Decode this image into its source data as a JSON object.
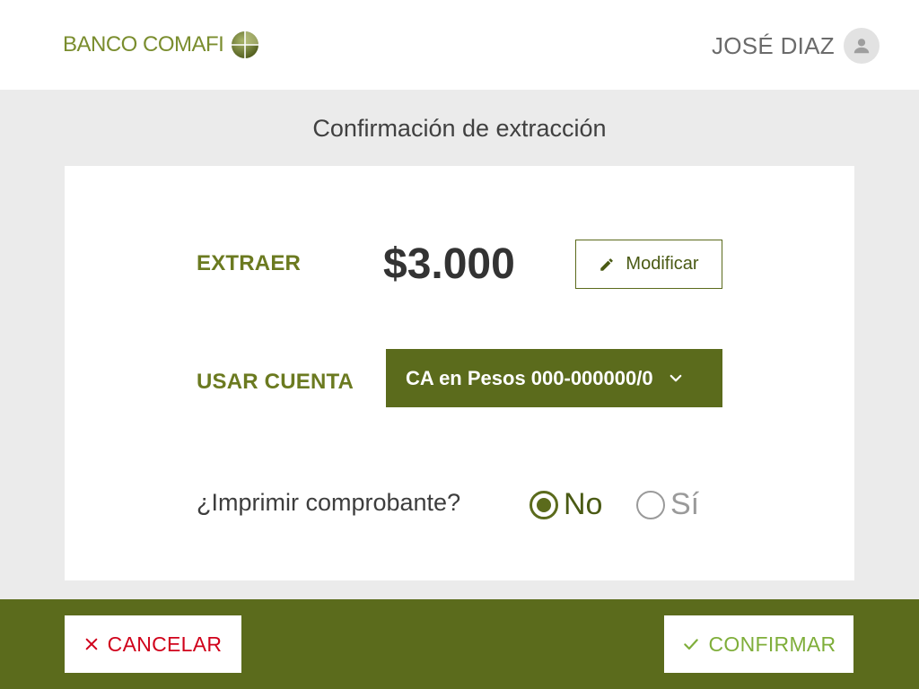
{
  "header": {
    "brand": "BANCO COMAFI",
    "user_name": "JOSÉ DIAZ"
  },
  "page": {
    "title": "Confirmación de extracción"
  },
  "withdraw": {
    "label": "EXTRAER",
    "amount": "$3.000",
    "modify_label": "Modificar"
  },
  "account": {
    "label": "USAR CUENTA",
    "selected": "CA en Pesos 000-000000/0"
  },
  "print_receipt": {
    "question": "¿Imprimir comprobante?",
    "options": [
      {
        "label": "No",
        "selected": true
      },
      {
        "label": "Sí",
        "selected": false
      }
    ]
  },
  "footer": {
    "cancel_label": "CANCELAR",
    "confirm_label": "CONFIRMAR"
  },
  "colors": {
    "brand_green": "#5b6b1c",
    "label_green": "#6b7a20",
    "cancel_red": "#d0021b",
    "confirm_green": "#7fae3a",
    "background": "#ebebeb"
  }
}
